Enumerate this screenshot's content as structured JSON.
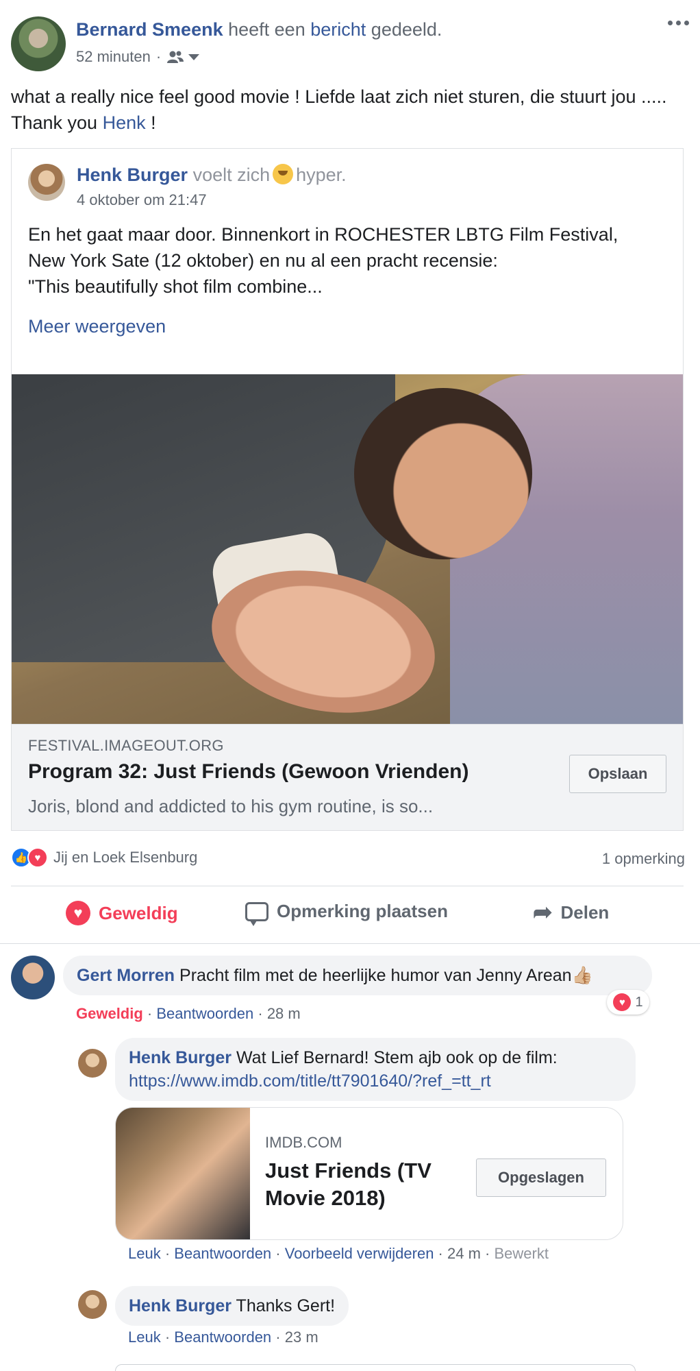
{
  "header": {
    "author": "Bernard Smeenk",
    "shared_text_1": "heeft een",
    "shared_link": "bericht",
    "shared_text_2": "gedeeld.",
    "time": "52 minuten",
    "separator": "·",
    "audience_icon": "friends-icon"
  },
  "post": {
    "text_1": "what a really nice feel good movie ! Liefde laat zich niet sturen, die stuurt jou ..... Thank you",
    "mention": "Henk",
    "text_2": "!"
  },
  "shared_post": {
    "author": "Henk Burger",
    "feeling_pre": "voelt zich",
    "feeling_emoji": "hyper-emoji",
    "feeling": "hyper.",
    "date": "4 oktober om 21:47",
    "text_line1": "En het gaat maar door. Binnenkort in ROCHESTER LBTG Film Festival,",
    "text_line2": "New York Sate (12 oktober) en nu al een pracht recensie:",
    "text_line3": "\"This beautifully shot film combine...",
    "see_more": "Meer weergeven",
    "link": {
      "domain": "FESTIVAL.IMAGEOUT.ORG",
      "title": "Program 32: Just Friends (Gewoon Vrienden)",
      "description": "Joris, blond and addicted to his gym routine, is so...",
      "save_label": "Opslaan"
    }
  },
  "reactions_summary": {
    "text": "Jij en Loek Elsenburg",
    "comments_count": "1 opmerking"
  },
  "actions": {
    "love": "Geweldig",
    "comment": "Opmerking plaatsen",
    "share": "Delen"
  },
  "comments": [
    {
      "author": "Gert Morren",
      "text": "Pracht film met de heerlijke humor van Jenny Arean",
      "emoji": "thumbs-up-emoji",
      "reaction_label": "Geweldig",
      "reply_label": "Beantwoorden",
      "time": "28 m",
      "reaction_count": "1"
    }
  ],
  "replies": [
    {
      "author": "Henk Burger",
      "text": "Wat Lief Bernard! Stem ajb ook op de film:",
      "url": "https://www.imdb.com/title/tt7901640/?ref_=tt_rt",
      "preview": {
        "domain": "IMDB.COM",
        "title": "Just Friends (TV Movie 2018)",
        "button": "Opgeslagen"
      },
      "like_label": "Leuk",
      "reply_label": "Beantwoorden",
      "remove_preview": "Voorbeeld verwijderen",
      "time": "24 m",
      "edited": "Bewerkt"
    },
    {
      "author": "Henk Burger",
      "text": "Thanks Gert!",
      "like_label": "Leuk",
      "reply_label": "Beantwoorden",
      "time": "23 m"
    }
  ],
  "colors": {
    "link": "#365899",
    "love": "#f33e58",
    "like": "#1877f2",
    "bubble": "#f2f3f5"
  }
}
